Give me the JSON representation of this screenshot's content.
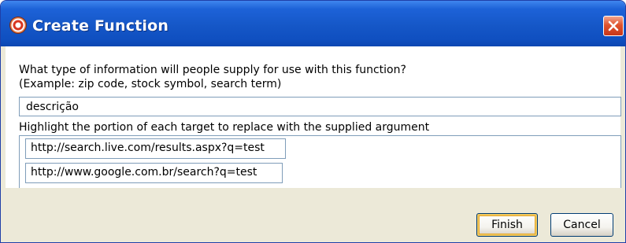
{
  "window": {
    "title": "Create Function"
  },
  "dialog": {
    "question_line1": "What type of information will people supply for use with this function?",
    "question_line2": "(Example: zip code, stock symbol, search term)",
    "argument_value": "descrição",
    "highlight_instruction": "Highlight the portion of each target to replace with the supplied argument",
    "targets": [
      "http://search.live.com/results.aspx?q=test",
      "http://www.google.com.br/search?q=test"
    ]
  },
  "buttons": {
    "finish_label": "Finish",
    "cancel_label": "Cancel"
  },
  "icons": {
    "app_icon": "function-target-icon",
    "close_icon": "close-icon"
  },
  "colors": {
    "titlebar": "#1557c7",
    "close_button": "#e0542e",
    "dialog_background": "#ece9d8",
    "input_border": "#7f9db9"
  }
}
